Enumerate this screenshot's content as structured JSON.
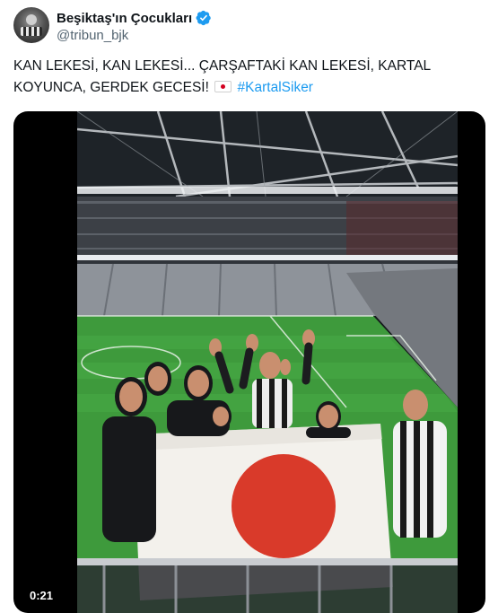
{
  "author": {
    "display_name": "Beşiktaş'ın Çocukları",
    "handle": "@tribun_bjk",
    "verified": true
  },
  "tweet": {
    "text": "KAN LEKESİ, KAN LEKESİ... ÇARŞAFTAKİ KAN LEKESİ, KARTAL KOYUNCA, GERDEK GECESİ!",
    "flag_emoji": "japan-flag-emoji",
    "hashtag": "#KartalSiker"
  },
  "media": {
    "type": "video",
    "duration": "0:21"
  },
  "colors": {
    "accent": "#1d9bf0",
    "text": "#0f1419",
    "secondary": "#536471"
  }
}
